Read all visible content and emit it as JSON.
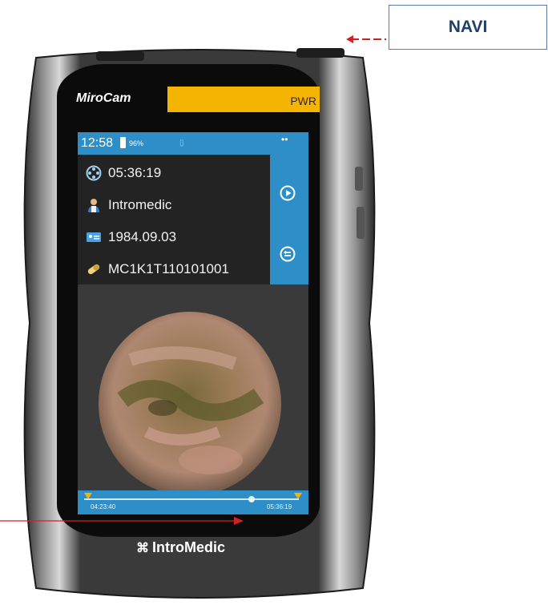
{
  "callout": {
    "label": "NAVI"
  },
  "device": {
    "brand": "MiroCam",
    "brand_mark": "®",
    "pwr_label": "PWR",
    "manufacturer_logo": "IntroMedic"
  },
  "status_bar": {
    "time": "12:58",
    "battery_percent": "96%",
    "battery_level": 0.96
  },
  "info": {
    "elapsed": "05:36:19",
    "patient_name": "Intromedic",
    "birth_date": "1984.09.03",
    "capsule_id": "MC1K1T110101001"
  },
  "side_buttons": [
    "play-icon",
    "back-icon"
  ],
  "timeline": {
    "start_time": "04:23:40",
    "end_time": "05:36:19",
    "position": 0.78
  },
  "colors": {
    "accent_blue": "#2e8fc8",
    "power_yellow": "#f5b400",
    "arrow_red": "#d42020"
  }
}
